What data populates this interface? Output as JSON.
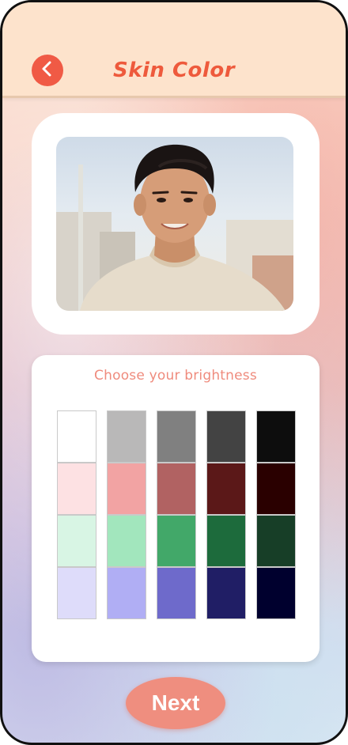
{
  "header": {
    "title": "Skin Color",
    "back_icon": "chevron-left-icon",
    "back_color": "#f05a45"
  },
  "photo": {
    "subject": "portrait-photo"
  },
  "brightness": {
    "prompt": "Choose your brightness",
    "swatches": [
      [
        "#ffffff",
        "#b9b8b8",
        "#808080",
        "#434343",
        "#0d0d0d"
      ],
      [
        "#fde1e3",
        "#f2a3a3",
        "#b16262",
        "#5b1818",
        "#2a0000"
      ],
      [
        "#d8f5e4",
        "#a2e6bd",
        "#42a869",
        "#1d6b3c",
        "#173e27"
      ],
      [
        "#dedcfa",
        "#b0aef4",
        "#6e6acb",
        "#201e65",
        "#00002e"
      ]
    ]
  },
  "footer": {
    "next_label": "Next"
  },
  "colors": {
    "accent": "#ee5a3c",
    "header_bg": "#fde3cc",
    "next_button": "#ef8e7f"
  }
}
